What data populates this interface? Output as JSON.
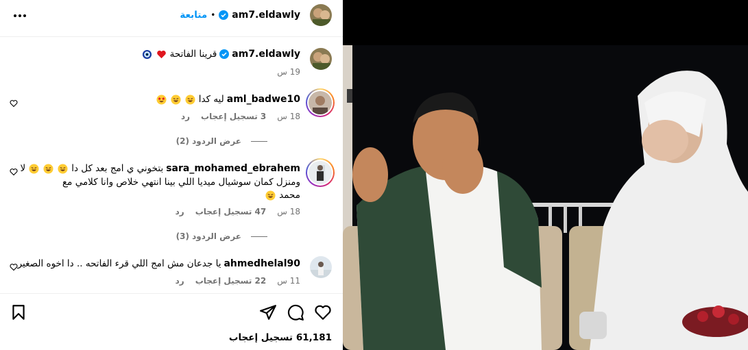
{
  "post": {
    "author": "am7.eldawly",
    "follow_label": "متابعة",
    "separator": "•",
    "more_icon": "more-horizontal-icon",
    "verified_icon": "verified-badge-icon",
    "caption": {
      "username": "am7.eldawly",
      "text": "قرينا الفاتحة",
      "emojis": [
        "red-heart-emoji",
        "nazar-amulet-emoji"
      ],
      "time": "19 س"
    },
    "likes_count": "61,181",
    "likes_label": "تسجيل إعجاب"
  },
  "comments": [
    {
      "username": "aml_badwe10",
      "text": "ليه كدا",
      "emojis": [
        "laughing-emoji",
        "laughing-emoji",
        "star-struck-emoji"
      ],
      "time": "18 س",
      "likes": "3 تسجيل إعجاب",
      "reply_label": "رد",
      "view_replies": "عرض الردود (2)"
    },
    {
      "username": "sara_mohamed_ebrahem",
      "text_line1": "بتخوني ي امج بعد كل دا",
      "text_line1_tail": "لا",
      "text_line2": "ومنزل كمان سوشيال ميديا اللي بينا انتهي خلاص وانا كلامي مع",
      "text_line3": "محمد",
      "emojis": [
        "laughing-emoji",
        "laughing-emoji",
        "laughing-emoji",
        "laughing-emoji"
      ],
      "time": "18 س",
      "likes": "47 تسجيل إعجاب",
      "reply_label": "رد",
      "view_replies": "عرض الردود (3)"
    },
    {
      "username": "ahmedhelal90",
      "text": "يا جدعان مش امج اللي قرء الفاتحه .. دا اخوه الصغير",
      "time": "11 س",
      "likes": "22 تسجيل إعجاب",
      "reply_label": "رد"
    }
  ],
  "actions": {
    "like_icon": "heart-icon",
    "comment_icon": "comment-icon",
    "share_icon": "share-icon",
    "save_icon": "bookmark-icon"
  },
  "colors": {
    "accent": "#0095f6",
    "muted": "#737373",
    "verified": "#0095f6",
    "divider": "#efefef"
  }
}
